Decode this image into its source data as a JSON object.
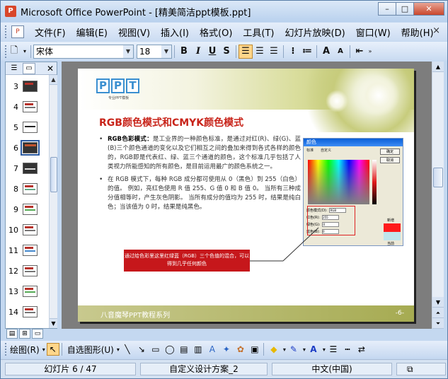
{
  "window": {
    "title": "Microsoft Office PowerPoint - [精美简洁ppt模板.ppt]",
    "min": "–",
    "max": "□",
    "close": "✕"
  },
  "menubar": {
    "items": [
      "文件(F)",
      "编辑(E)",
      "视图(V)",
      "插入(I)",
      "格式(O)",
      "工具(T)",
      "幻灯片放映(D)",
      "窗口(W)",
      "帮助(H)"
    ],
    "close": "×"
  },
  "toolbar": {
    "font": "宋体",
    "size": "18",
    "bold": "B",
    "italic": "I",
    "underline": "U",
    "shadow": "S"
  },
  "thumbnails": [
    {
      "num": "3"
    },
    {
      "num": "4"
    },
    {
      "num": "5"
    },
    {
      "num": "6"
    },
    {
      "num": "7"
    },
    {
      "num": "8"
    },
    {
      "num": "9"
    },
    {
      "num": "10"
    },
    {
      "num": "11"
    },
    {
      "num": "12"
    },
    {
      "num": "13"
    },
    {
      "num": "14"
    }
  ],
  "slide": {
    "logo": [
      "P",
      "P",
      "T"
    ],
    "logo_sub": "专业PPT模板",
    "title": "RGB颜色模式和CMYK颜色模式",
    "bullet1_lead": "RGB色彩模式：",
    "bullet1": "是工业界的一种颜色标准，是通过对红(R)、绿(G)、蓝(B)三个颜色通道的变化以及它们相互之间的叠加来得到各式各样的颜色的，RGB即是代表红、绿、蓝三个通道的颜色，这个标准几乎包括了人类视力所能感知的所有颜色，是目前运用最广的颜色系统之一。",
    "bullet2": "在 RGB 模式下，每种 RGB 成分都可使用从 0（黑色）到 255（白色）的值。 例如，亮红色使用 R 值 255、G 值 0 和 B 值 0。 当所有三种成分值相等时，产生灰色阴影。 当所有成分的值均为 255 时，结果是纯白色；当该值为 0 时，结果是纯黑色。",
    "callout": "通过给色彩里这里红绿蓝（RGB）三个色值的混合，可以得到几乎任何颜色",
    "footer": "八音魔琴PPT教程系列",
    "page": "-6-",
    "dialog": {
      "title": "颜色",
      "tabs": [
        "标准",
        "自定义"
      ],
      "ok": "确定",
      "cancel": "取消",
      "new": "新增",
      "current": "当前",
      "fields": [
        {
          "label": "颜色模式(D):",
          "value": "RGB"
        },
        {
          "label": "红色(R):",
          "value": "255"
        },
        {
          "label": "绿色(G):",
          "value": "0"
        },
        {
          "label": "蓝色(B):",
          "value": "0"
        }
      ]
    }
  },
  "drawbar": {
    "draw": "绘图(R)",
    "autoshape": "自选图形(U)"
  },
  "status": {
    "slide": "幻灯片 6 / 47",
    "design": "自定义设计方案_2",
    "lang": "中文(中国)"
  }
}
